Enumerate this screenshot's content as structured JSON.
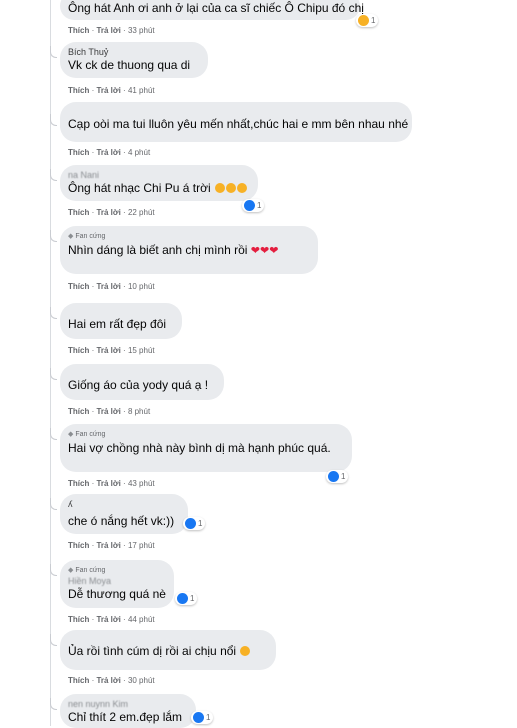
{
  "comments": [
    {
      "author": "",
      "text": "Ông hát Anh ơi anh ở lại của ca sĩ chiếc Ô Chipu đó chị",
      "time": "33 phút",
      "reaction_count": "1"
    },
    {
      "author": "Bích Thuỷ",
      "text": "Vk ck de thuong qua di",
      "time": "41 phút"
    },
    {
      "author": "",
      "text": "Cạp oòi ma tui lluôn yêu mến nhất,chúc hai e mm bên nhau nhé",
      "time": "4 phút"
    },
    {
      "author": "na Nani",
      "text": "Ông hát nhạc Chi Pu á trời",
      "time": "22 phút",
      "reaction_count": "1"
    },
    {
      "badge": "Fan cứng",
      "text": "Nhìn dáng là biết anh chị mình rồi",
      "time": "10 phút"
    },
    {
      "text": "Hai em rất đẹp đôi",
      "time": "15 phút"
    },
    {
      "text": "Giống áo của yody quá ạ !",
      "time": "8 phút"
    },
    {
      "badge": "Fan cứng",
      "text": "Hai vợ chồng nhà này bình dị mà hạnh phúc quá.",
      "time": "43 phút",
      "reaction_count": "1"
    },
    {
      "author": "ʎ",
      "text": "che ó nắng hết vk:))",
      "time": "17 phút",
      "reaction_count": "1"
    },
    {
      "badge": "Fan cứng",
      "author": "Hiền Moya",
      "text": "Dễ thương quá nè",
      "time": "44 phút",
      "reaction_count": "1"
    },
    {
      "text": "Ủa rồi tình cúm dị rồi ai chịu nổi",
      "time": "30 phút"
    },
    {
      "author": "nen nuynn Kim",
      "text": "Chỉ thít 2 em.đẹp lắm",
      "reaction_count": "1"
    }
  ],
  "labels": {
    "like": "Thích",
    "reply": "Trả lời",
    "sep": " · "
  },
  "colors": {
    "bubble": "#e9ebee",
    "like": "#1877f2",
    "haha": "#f7b125",
    "heart": "#e41e3f"
  }
}
